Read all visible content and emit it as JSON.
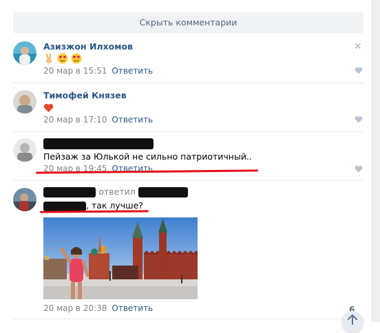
{
  "hide_comments_label": "Скрыть комментарии",
  "reply_label": "Ответить",
  "comments": [
    {
      "author": "Азизжон Илхомов",
      "text": "",
      "time": "20 мар в 15:51"
    },
    {
      "author": "Тимофей Князев",
      "text": "",
      "time": "20 мар в 17:10"
    },
    {
      "author": "",
      "text": "Пейзаж за Юлькой не сильно патриотичный..",
      "time": "20 мар в 19:45"
    },
    {
      "author": "",
      "replied_label": "ответил",
      "text": ", так лучше?",
      "time": "20 мар в 20:38",
      "likes": "6"
    }
  ],
  "colors": {
    "accent": "#2a5885",
    "annotation_red": "#e3101b",
    "heart": "#b9c4d0"
  }
}
